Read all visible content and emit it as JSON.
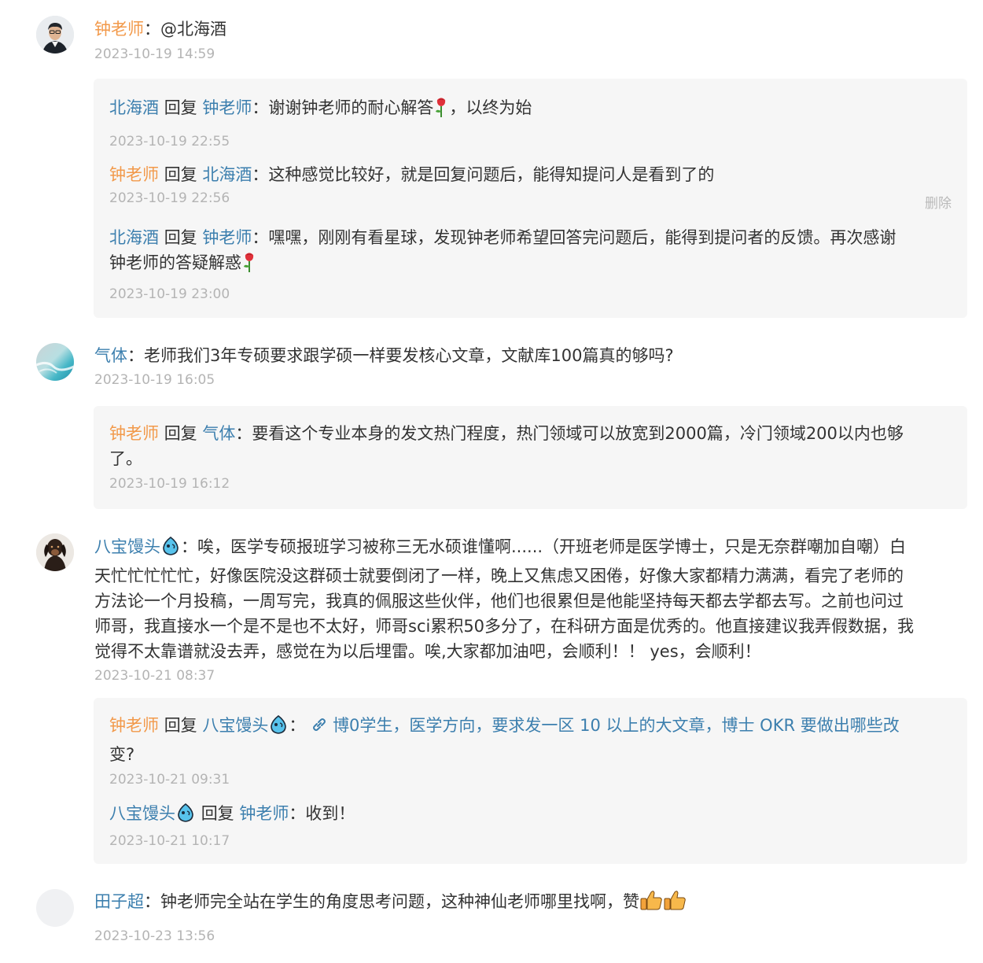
{
  "comments": [
    {
      "author": "钟老师",
      "text": "@北海酒",
      "time": "2023-10-19 14:59",
      "replies": [
        {
          "from": "北海酒",
          "verb": "回复",
          "to": "钟老师",
          "text": "谢谢钟老师的耐心解答",
          "text_after": "，以终为始",
          "time": "2023-10-19 22:55"
        },
        {
          "from": "钟老师",
          "verb": "回复",
          "to": "北海酒",
          "text": "这种感觉比较好，就是回复问题后，能得知提问人是看到了的",
          "time": "2023-10-19 22:56",
          "action": "删除"
        },
        {
          "from": "北海酒",
          "verb": "回复",
          "to": "钟老师",
          "text_line1": "嘿嘿，刚刚有看星球，发现钟老师希望回答完问题后，能得到提问者的反馈。再次感谢",
          "text_line2": "钟老师的答疑解惑",
          "time": "2023-10-19 23:00"
        }
      ]
    },
    {
      "author": "气体",
      "text": "老师我们3年专硕要求跟学硕一样要发核心文章，文献库100篇真的够吗?",
      "time": "2023-10-19 16:05",
      "replies": [
        {
          "from": "钟老师",
          "verb": "回复",
          "to": "气体",
          "text_line1": "要看这个专业本身的发文热门程度，热门领域可以放宽到2000篇，冷门领域200以内也够",
          "text_line2": "了。",
          "time": "2023-10-19 16:12"
        }
      ]
    },
    {
      "author": "八宝馒头",
      "lines": [
        "唉，医学专硕报班学习被称三无水硕谁懂啊......（开班老师是医学博士，只是无奈群嘲加自嘲）白",
        "天忙忙忙忙忙，好像医院没这群硕士就要倒闭了一样，晚上又焦虑又困倦，好像大家都精力满满，看完了老师的",
        "方法论一个月投稿，一周写完，我真的佩服这些伙伴，他们也很累但是他能坚持每天都去学都去写。之前也问过",
        "师哥，我直接水一个是不是也不太好，师哥sci累积50多分了，在科研方面是优秀的。他直接建议我弄假数据，我",
        "觉得不太靠谱就没去弄，感觉在为以后埋雷。唉,大家都加油吧，会顺利！！ yes，会顺利！"
      ],
      "time": "2023-10-21 08:37",
      "replies": [
        {
          "from": "钟老师",
          "verb": "回复",
          "to": "八宝馒头",
          "link_line1": "博0学生，医学方向，要求发一区 10 以上的大文章，博士 OKR 要做出哪些改",
          "link_line2": "变?",
          "time": "2023-10-21 09:31"
        },
        {
          "from": "八宝馒头",
          "verb": "回复",
          "to": "钟老师",
          "text": "收到！",
          "time": "2023-10-21 10:17"
        }
      ]
    },
    {
      "author": "田子超",
      "text": "钟老师完全站在学生的角度思考问题，这种神仙老师哪里找啊，赞",
      "time": "2023-10-23 13:56"
    }
  ],
  "separator": "："
}
